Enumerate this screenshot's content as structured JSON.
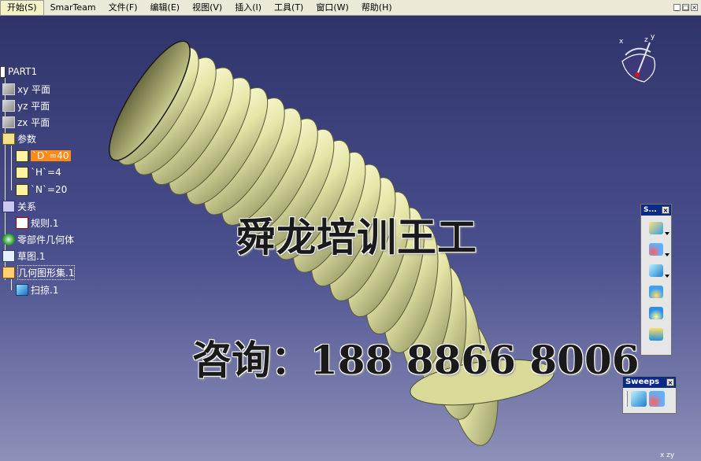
{
  "menubar": {
    "items": [
      "开始(S)",
      "SmarTeam",
      "文件(F)",
      "编辑(E)",
      "视图(V)",
      "插入(I)",
      "工具(T)",
      "窗口(W)",
      "帮助(H)"
    ]
  },
  "tree": {
    "root": "PART1",
    "planes": [
      "xy 平面",
      "yz 平面",
      "zx 平面"
    ],
    "parameters_label": "参数",
    "parameters": [
      "`D`=40",
      "`H`=4",
      "`N`=20"
    ],
    "relations_label": "关系",
    "rule": "规则.1",
    "body": "零部件几何体",
    "sketch": "草图.1",
    "geoset": "几何图形集.1",
    "sweep": "扫掠.1"
  },
  "watermark": {
    "line1": "舜龙培训王工",
    "line2_prefix": "咨询：",
    "line2_number": "188 8866 8006"
  },
  "toolbar_vertical": {
    "title": "S...",
    "close": "×",
    "icons": [
      "sweep-line-icon",
      "sweep-circle-icon",
      "sweep-conic-icon",
      "adaptive-sweep-icon",
      "blend-icon",
      "multi-section-icon"
    ]
  },
  "toolbar_sweeps": {
    "title": "Sweeps",
    "close": "×",
    "icons": [
      "sweep-icon",
      "adaptive-sweep-icon"
    ]
  },
  "compass": {
    "x": "x",
    "y": "y",
    "z": "z"
  },
  "axis_bottom": "x zy",
  "colors": {
    "menubar_bg": "#ece9d8",
    "highlight": "#ff8a18",
    "bellows": "#e4e6a6",
    "toolbar_title": "#0a2a8a"
  }
}
